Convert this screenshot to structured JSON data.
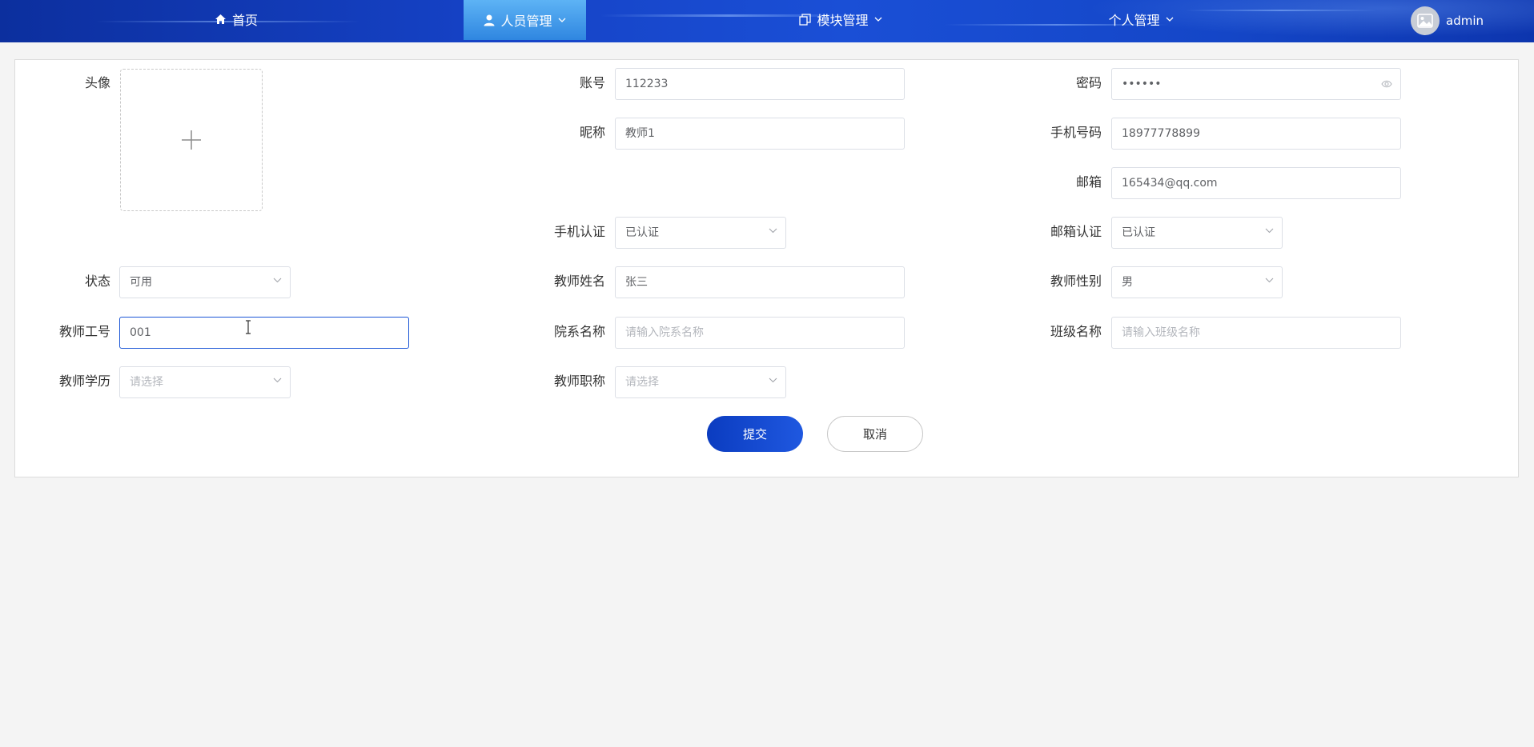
{
  "nav": {
    "home": "首页",
    "personnel": "人员管理",
    "modules": "模块管理",
    "personal": "个人管理",
    "user": "admin"
  },
  "form": {
    "avatar_label": "头像",
    "account_label": "账号",
    "account_value": "112233",
    "password_label": "密码",
    "password_value": "••••••",
    "nickname_label": "昵称",
    "nickname_value": "教师1",
    "phone_label": "手机号码",
    "phone_value": "18977778899",
    "email_label": "邮箱",
    "email_value": "165434@qq.com",
    "phone_verify_label": "手机认证",
    "phone_verify_value": "已认证",
    "email_verify_label": "邮箱认证",
    "email_verify_value": "已认证",
    "status_label": "状态",
    "status_value": "可用",
    "teacher_name_label": "教师姓名",
    "teacher_name_value": "张三",
    "teacher_gender_label": "教师性别",
    "teacher_gender_value": "男",
    "teacher_no_label": "教师工号",
    "teacher_no_value": "001",
    "department_label": "院系名称",
    "department_placeholder": "请输入院系名称",
    "class_label": "班级名称",
    "class_placeholder": "请输入班级名称",
    "education_label": "教师学历",
    "education_placeholder": "请选择",
    "title_label": "教师职称",
    "title_placeholder": "请选择",
    "submit": "提交",
    "cancel": "取消"
  },
  "colors": {
    "nav_bg": "#1541c4",
    "nav_active": "#3d97ea",
    "primary": "#1b56d6"
  }
}
